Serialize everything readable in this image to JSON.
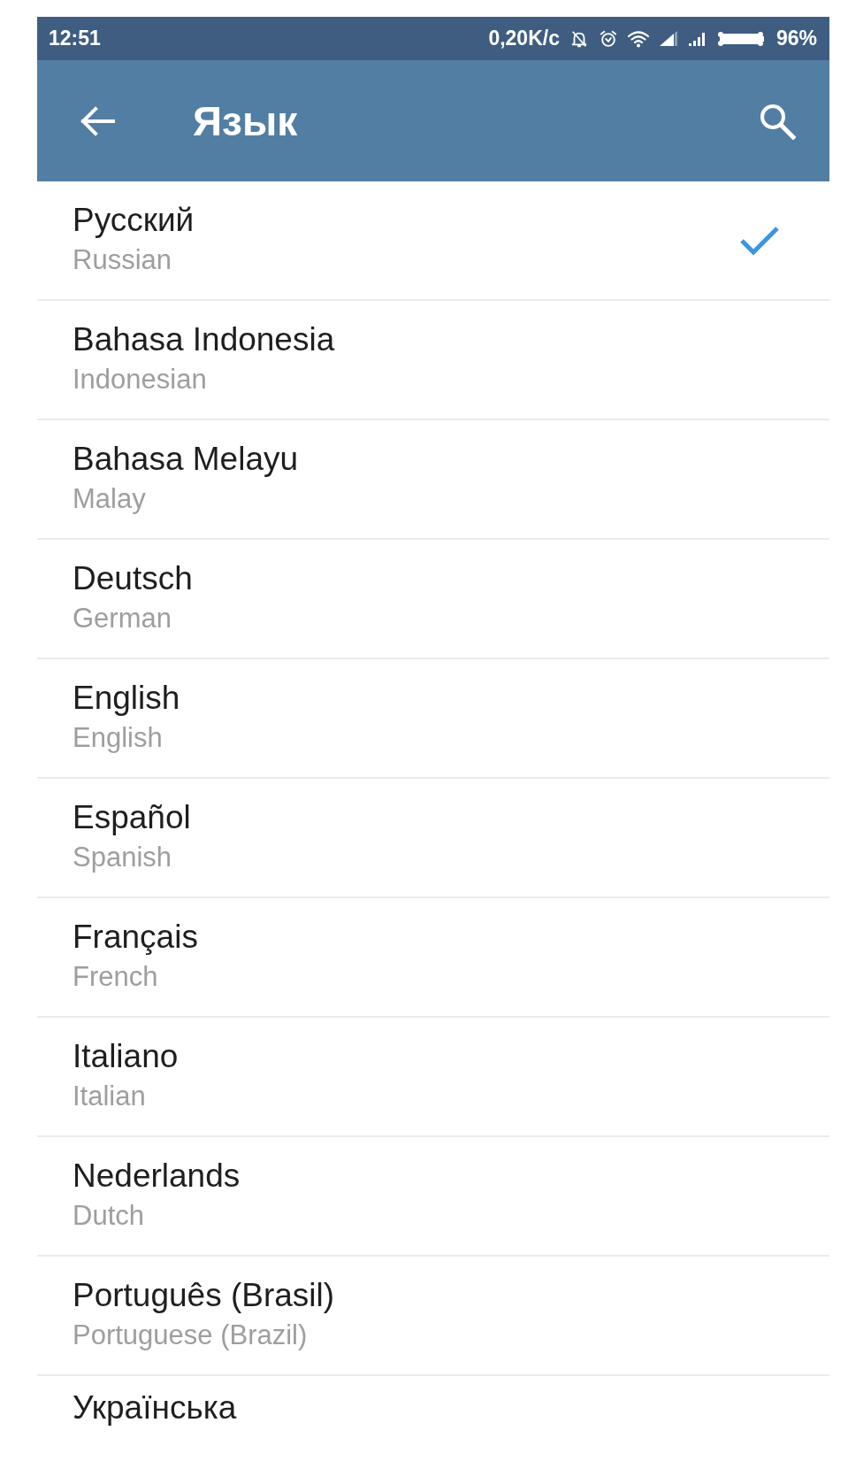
{
  "status_bar": {
    "time": "12:51",
    "network_speed": "0,20K/c",
    "battery_percent": "96%"
  },
  "header": {
    "title": "Язык"
  },
  "languages": [
    {
      "name": "Русский",
      "english_name": "Russian",
      "selected": true
    },
    {
      "name": "Bahasa Indonesia",
      "english_name": "Indonesian",
      "selected": false
    },
    {
      "name": "Bahasa Melayu",
      "english_name": "Malay",
      "selected": false
    },
    {
      "name": "Deutsch",
      "english_name": "German",
      "selected": false
    },
    {
      "name": "English",
      "english_name": "English",
      "selected": false
    },
    {
      "name": "Español",
      "english_name": "Spanish",
      "selected": false
    },
    {
      "name": "Français",
      "english_name": "French",
      "selected": false
    },
    {
      "name": "Italiano",
      "english_name": "Italian",
      "selected": false
    },
    {
      "name": "Nederlands",
      "english_name": "Dutch",
      "selected": false
    },
    {
      "name": "Português (Brasil)",
      "english_name": "Portuguese (Brazil)",
      "selected": false
    },
    {
      "name": "Українська",
      "selected": false
    }
  ]
}
